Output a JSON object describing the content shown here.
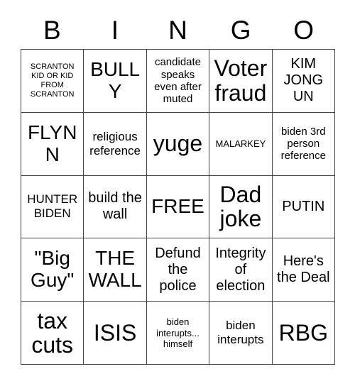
{
  "card": {
    "header_letters": [
      "B",
      "I",
      "N",
      "G",
      "O"
    ],
    "columns": 5,
    "rows": 5,
    "free_space_text": "FREE",
    "border_color": "#444444",
    "background_color": "#ffffff",
    "text_color": "#000000"
  },
  "cells": [
    {
      "text": "SCRANTON KID OR KID FROM SCRANTON",
      "size": "fs-xxs"
    },
    {
      "text": "BULLY",
      "size": "fs-xxl"
    },
    {
      "text": "candidate speaks even after muted",
      "size": "fs-sm"
    },
    {
      "text": "Voter fraud",
      "size": "fs-3xl"
    },
    {
      "text": "KIM JONG UN",
      "size": "fs-lg"
    },
    {
      "text": "FLYNN",
      "size": "fs-xxl"
    },
    {
      "text": "religious reference",
      "size": "fs-md"
    },
    {
      "text": "yuge",
      "size": "fs-3xl"
    },
    {
      "text": "MALARKEY",
      "size": "fs-xs"
    },
    {
      "text": "biden 3rd person reference",
      "size": "fs-sm"
    },
    {
      "text": "HUNTER BIDEN",
      "size": "fs-md"
    },
    {
      "text": "build the wall",
      "size": "fs-lg"
    },
    {
      "text": "FREE",
      "size": "fs-xxl"
    },
    {
      "text": "Dad joke",
      "size": "fs-3xl"
    },
    {
      "text": "PUTIN",
      "size": "fs-lg"
    },
    {
      "text": "\"Big Guy\"",
      "size": "fs-xxl"
    },
    {
      "text": "THE WALL",
      "size": "fs-xxl"
    },
    {
      "text": "Defund the police",
      "size": "fs-lg"
    },
    {
      "text": "Integrity of election",
      "size": "fs-lg"
    },
    {
      "text": "Here's the Deal",
      "size": "fs-lg"
    },
    {
      "text": "tax cuts",
      "size": "fs-3xl"
    },
    {
      "text": "ISIS",
      "size": "fs-3xl"
    },
    {
      "text": "biden interupts... himself",
      "size": "fs-xs"
    },
    {
      "text": "biden interupts",
      "size": "fs-md"
    },
    {
      "text": "RBG",
      "size": "fs-3xl"
    }
  ]
}
